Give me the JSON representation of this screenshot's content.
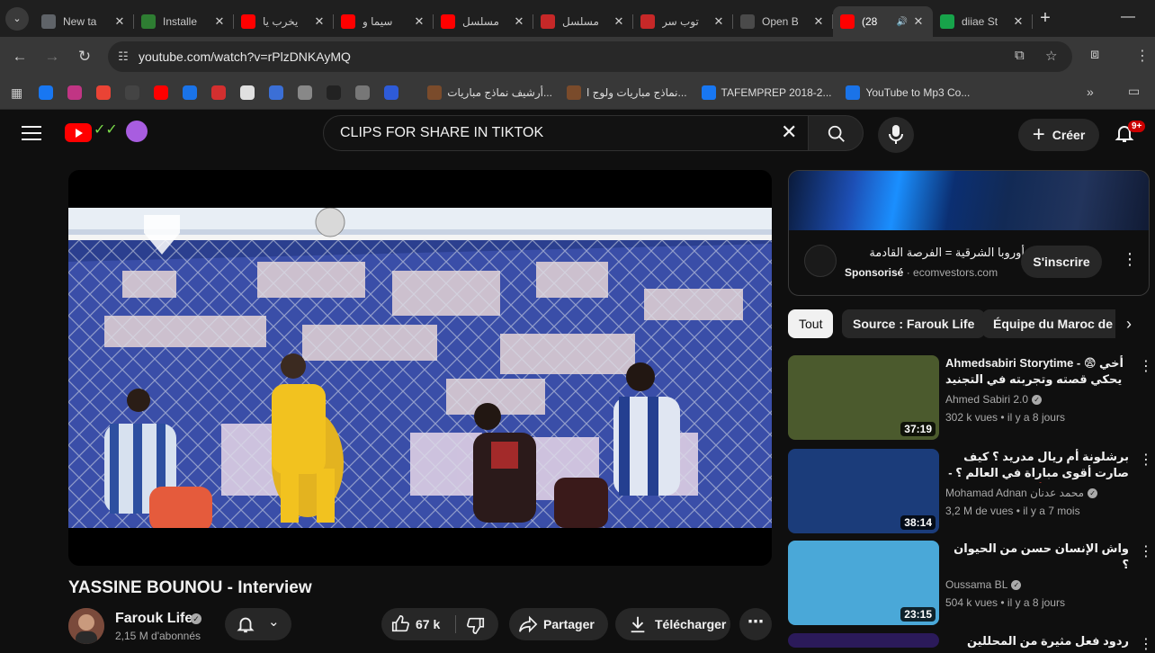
{
  "browser": {
    "tabs": [
      {
        "title": "New ta",
        "icon": "chrome-icon",
        "color": "#5f6368",
        "active": false
      },
      {
        "title": "Installe",
        "icon": "bolt-icon",
        "color": "#2e7d32",
        "active": false
      },
      {
        "title": "يخرب يا",
        "icon": "youtube-icon",
        "color": "#ff0000",
        "active": false
      },
      {
        "title": "سيما و",
        "icon": "youtube-icon",
        "color": "#ff0000",
        "active": false
      },
      {
        "title": "مسلسل",
        "icon": "youtube-icon",
        "color": "#ff0000",
        "active": false
      },
      {
        "title": "مسلسل",
        "icon": "tou-icon",
        "color": "#c62828",
        "active": false
      },
      {
        "title": "توب سر",
        "icon": "tou-icon",
        "color": "#c62828",
        "active": false
      },
      {
        "title": "Open B",
        "icon": "openai-icon",
        "color": "#4a4a4a",
        "active": false
      },
      {
        "title": "(28",
        "icon": "youtube-icon",
        "color": "#ff0000",
        "active": true
      },
      {
        "title": "diiae St",
        "icon": "k-icon",
        "color": "#17a34a",
        "active": false
      }
    ],
    "url": "youtube.com/watch?v=rPlzDNKAyMQ",
    "bookmarks": [
      {
        "label": "أرشيف نماذج مباريات...",
        "color": "#7a4b2b"
      },
      {
        "label": "نماذج مباريات ولوج ا...",
        "color": "#7a4b2b"
      },
      {
        "label": "TAFEMPREP 2018-2...",
        "color": "#1877f2"
      },
      {
        "label": "YouTube to Mp3 Co...",
        "color": "#1a73e8"
      }
    ]
  },
  "youtube": {
    "search_query": "CLIPS FOR SHARE IN TIKTOK",
    "create_label": "Créer",
    "notifications_badge": "9+",
    "video": {
      "title": "YASSINE BOUNOU - Interview",
      "channel": "Farouk Life",
      "subscribers": "2,15 M d'abonnés",
      "likes": "67 k",
      "share_label": "Partager",
      "download_label": "Télécharger"
    },
    "ad": {
      "title": "أوروبا الشرقية = الفرصة القادمة",
      "sponsored_label": "Sponsorisé",
      "domain": "ecomvestors.com",
      "subscribe_label": "S'inscrire"
    },
    "chips": [
      "Tout",
      "Source : Farouk Life",
      "Équipe du Maroc de"
    ],
    "recommendations": [
      {
        "title": "Ahmedsabiri Storytime - 😨 أخي يحكي قصته وتجربته في التجنيد شاف جنون",
        "channel": "Ahmed Sabiri 2.0",
        "views": "302 k vues",
        "age": "il y a 8 jours",
        "duration": "37:19",
        "rtl": false,
        "thumb_bg": "#4b5a2d"
      },
      {
        "title": "برشلونة أم ريال مدريد ؟ كيف صارت أقوى مباراة في العالم ؟ - القصة الكاملة 🔥",
        "channel": "Mohamad Adnan محمد عدنان",
        "views": "3,2 M de vues",
        "age": "il y a 7 mois",
        "duration": "38:14",
        "rtl": true,
        "thumb_bg": "#1b3c7a"
      },
      {
        "title": "واش الإنسان حسن من الحيوان ؟",
        "channel": "Oussama BL",
        "views": "504 k vues",
        "age": "il y a 8 jours",
        "duration": "23:15",
        "rtl": true,
        "thumb_bg": "#4aa8d8"
      },
      {
        "title": "ردود فعل مثيرة من المحللين على إقصاء",
        "channel": "",
        "views": "",
        "age": "",
        "duration": "",
        "rtl": true,
        "thumb_bg": "#2b1a5a"
      }
    ]
  }
}
